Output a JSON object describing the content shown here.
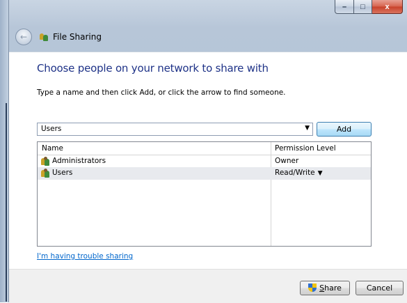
{
  "window": {
    "title": "File Sharing",
    "controls": {
      "minimize": "–",
      "maximize": "□",
      "close": "x"
    }
  },
  "main": {
    "heading": "Choose people on your network to share with",
    "instruction": "Type a name and then click Add, or click the arrow to find someone.",
    "name_input": {
      "value": "Users"
    },
    "add_label": "Add",
    "table": {
      "columns": [
        "Name",
        "Permission Level"
      ],
      "rows": [
        {
          "name": "Administrators",
          "permission": "Owner",
          "selected": false
        },
        {
          "name": "Users",
          "permission": "Read/Write",
          "selected": true
        }
      ]
    },
    "trouble_link": "I'm having trouble sharing"
  },
  "footer": {
    "share_label_prefix": "S",
    "share_label_rest": "hare",
    "cancel_label": "Cancel"
  },
  "colors": {
    "heading": "#1e3287",
    "link": "#0066cc",
    "selected_row": "#e8eaee"
  }
}
